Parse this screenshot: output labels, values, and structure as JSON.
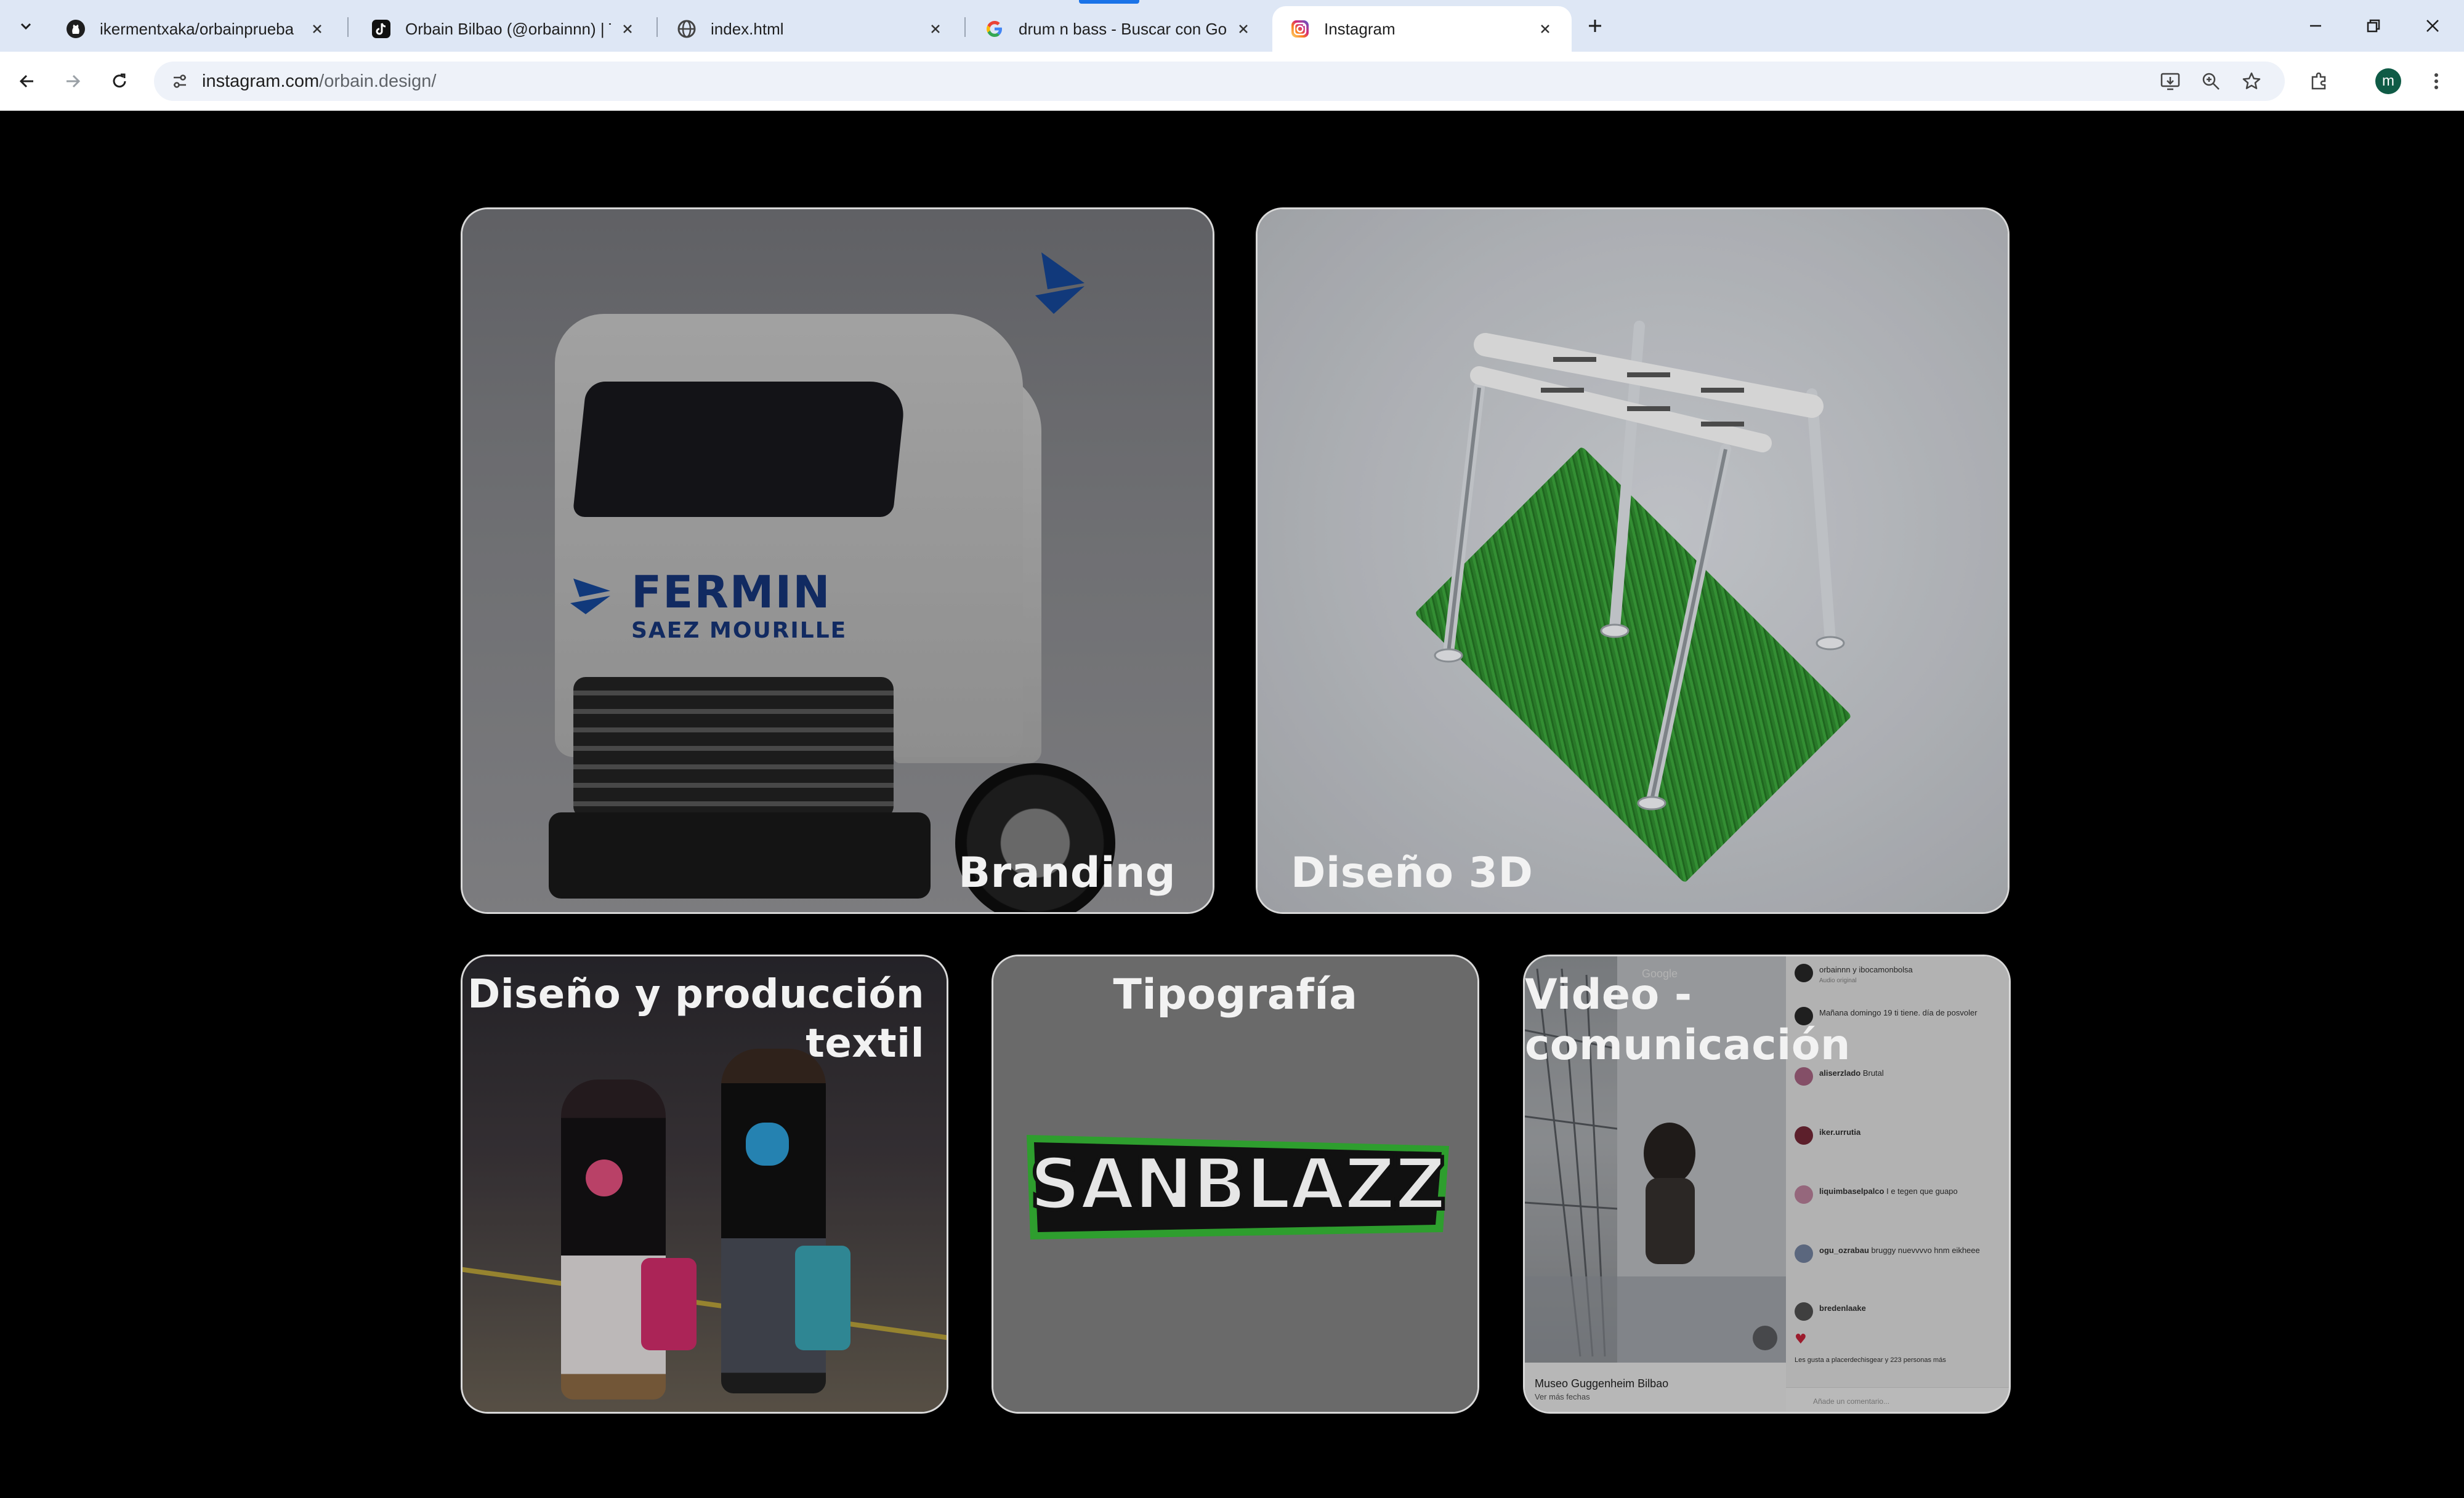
{
  "browser": {
    "tabs": [
      {
        "title": "ikermentxaka/orbainprueba",
        "icon": "github-icon",
        "active": false
      },
      {
        "title": "Orbain Bilbao (@orbainnn) | Tik",
        "icon": "tiktok-icon",
        "active": false
      },
      {
        "title": "index.html",
        "icon": "globe-icon",
        "active": false
      },
      {
        "title": "drum n bass - Buscar con Goog",
        "icon": "google-icon",
        "active": false
      },
      {
        "title": "Instagram",
        "icon": "instagram-icon",
        "active": true
      }
    ],
    "url": {
      "domain": "instagram.com",
      "path": "/orbain.design/"
    },
    "profile_initial": "m",
    "accent": "#1a73e8"
  },
  "page": {
    "cards": {
      "branding": {
        "label": "Branding"
      },
      "diseno3d": {
        "label": "Diseño 3D"
      },
      "textil": {
        "label_line1": "Diseño y producción",
        "label_line2": "textil"
      },
      "tipografia": {
        "label": "Tipografía",
        "graffiti_text": "SANBLAZZ"
      },
      "video": {
        "label": "Video - comunicación"
      }
    },
    "truck": {
      "brand": "FERMIN",
      "brand_sub": "SAEZ MOURILLE"
    },
    "video_post": {
      "google_tag": "Google",
      "location": "Museo Guggenheim Bilbao",
      "location_sub": "Ver más fechas",
      "header_user": "orbainnn y ibocamonbolsa",
      "header_sub": "Audio original",
      "caption": "Mañana domingo 19 ti tiene. día de posvoler",
      "comments": [
        {
          "user": "aliserzlado",
          "text": "Brutal"
        },
        {
          "user": "iker.urrutia",
          "text": ""
        },
        {
          "user": "liquimbaselpalco",
          "text": "I e tegen que guapo"
        },
        {
          "user": "ogu_ozrabau",
          "text": "bruggy nuevvvvo hnm eikheee"
        },
        {
          "user": "bredenlaake",
          "text": ""
        }
      ],
      "likes": "Les gusta a placerdechisgear y 223 personas más",
      "add_comment": "Añade un comentario..."
    }
  }
}
